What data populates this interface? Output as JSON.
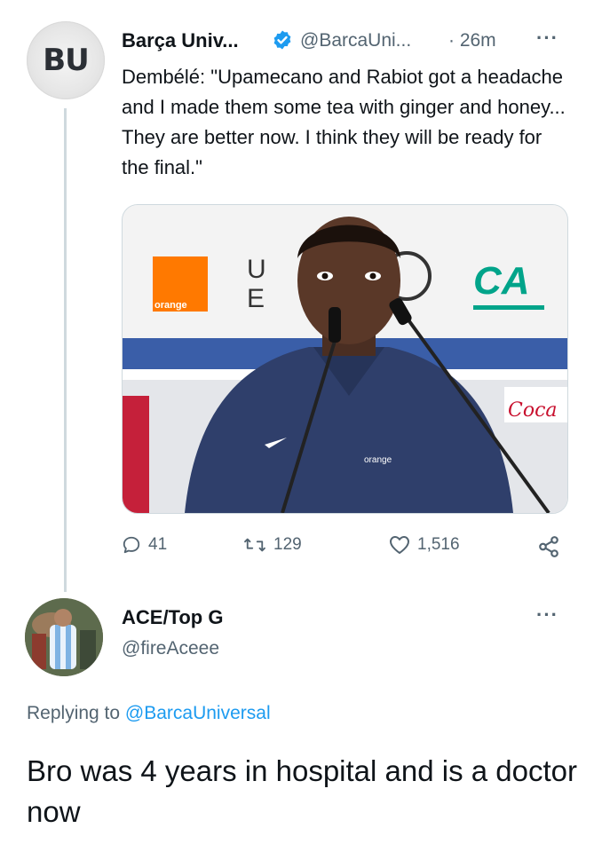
{
  "tweet": {
    "author_name": "Barça Univ...",
    "author_handle": "@BarcaUni...",
    "time": "· 26m",
    "more": "···",
    "avatar_text": "BU",
    "text": "Dembélé: \"Upamecano and Rabiot got a headache and I made them some tea with ginger and honey... They are better now. I think they will be ready for the final.\"",
    "media_logos": {
      "sponsor_left": "orange",
      "sponsor_right": "CA",
      "partial_left": "U​E",
      "partial_right": "Coca",
      "shirt": "orange"
    },
    "actions": {
      "replies": "41",
      "retweets": "129",
      "likes": "1,516"
    }
  },
  "reply": {
    "author_name": "ACE/Top G",
    "author_handle": "@fireAceee",
    "more": "···",
    "replying_prefix": "Replying to ",
    "replying_mention": "@BarcaUniversal",
    "text": "Bro was 4 years in hospital and is a doctor now"
  },
  "colors": {
    "verified": "#1d9bf0",
    "secondary_text": "#536471",
    "link": "#1d9bf0",
    "orange_brand": "#ff7900",
    "ca_green": "#00a48a"
  },
  "icons": [
    "verified-badge-icon",
    "reply-icon",
    "retweet-icon",
    "like-icon",
    "share-icon",
    "more-icon"
  ]
}
